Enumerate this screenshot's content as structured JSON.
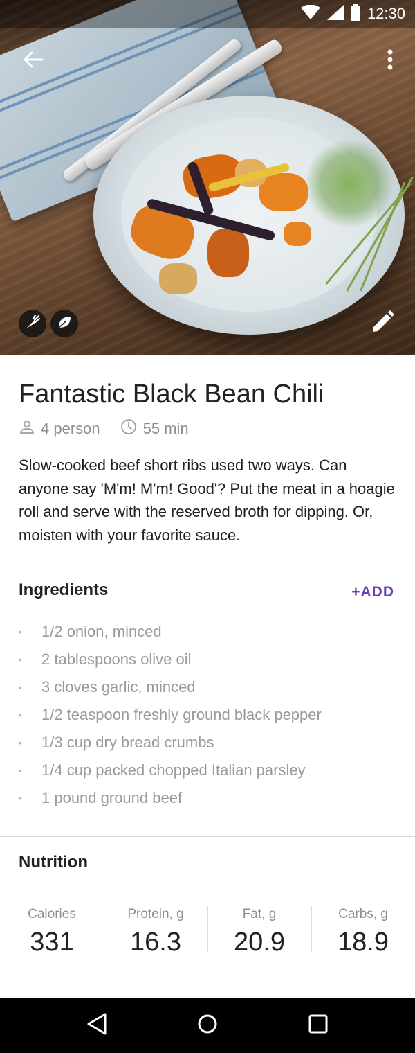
{
  "status_bar": {
    "time": "12:30"
  },
  "recipe": {
    "title": "Fantastic Black Bean Chili",
    "servings": "4 person",
    "duration": "55 min",
    "description": "Slow-cooked beef short ribs used two ways. Can anyone say 'M'm! M'm! Good'? Put the meat in a hoagie roll and serve with the reserved broth for dipping. Or, moisten with your favorite sauce."
  },
  "ingredients": {
    "title": "Ingredients",
    "add_label": "+ADD",
    "items": [
      "1/2 onion, minced",
      "2 tablespoons olive oil",
      "3 cloves garlic, minced",
      "1/2 teaspoon freshly ground black pepper",
      "1/3 cup dry bread crumbs",
      "1/4 cup packed chopped Italian parsley",
      "1 pound ground beef"
    ]
  },
  "nutrition": {
    "title": "Nutrition",
    "items": [
      {
        "label": "Calories",
        "value": "331"
      },
      {
        "label": "Protein, g",
        "value": "16.3"
      },
      {
        "label": "Fat, g",
        "value": "20.9"
      },
      {
        "label": "Carbs, g",
        "value": "18.9"
      }
    ]
  },
  "icons": {
    "back": "arrow-back-icon",
    "more": "more-vert-icon",
    "badge_1": "carrot-icon",
    "badge_2": "leaf-icon",
    "edit": "pencil-icon",
    "servings": "person-icon",
    "duration": "clock-icon"
  },
  "colors": {
    "accent": "#6a3fb0",
    "text_primary": "#212121",
    "text_secondary": "#8e8e8e"
  }
}
